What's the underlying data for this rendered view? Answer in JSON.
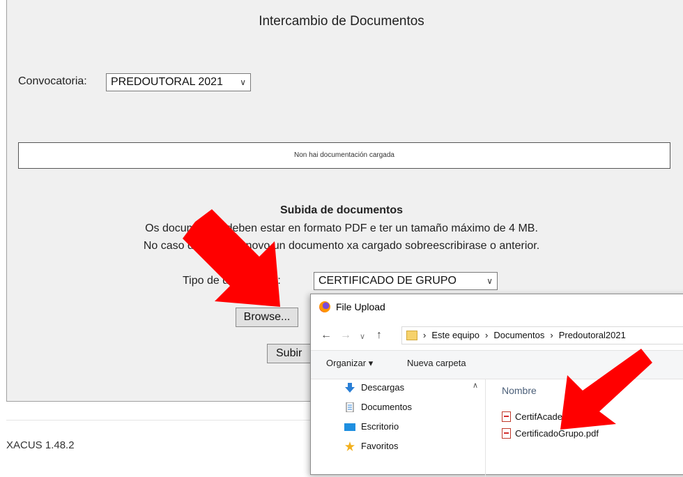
{
  "page": {
    "title": "Intercambio de Documentos",
    "convocatoria_label": "Convocatoria:",
    "convocatoria_value": "PREDOUTORAL 2021",
    "no_docs_text": "Non hai documentación cargada",
    "upload_title": "Subida de documentos",
    "upload_line1": "Os documentos deben estar en formato PDF e ter un tamaño máximo de 4 MB.",
    "upload_line2": "No caso de subir de novo un documento xa cargado sobreescribirase o anterior.",
    "tipo_label": "Tipo de documento:",
    "tipo_value": "CERTIFICADO DE GRUPO",
    "browse_label": "Browse...",
    "submit_label": "Subir",
    "footer": "XACUS 1.48.2"
  },
  "dialog": {
    "title": "File Upload",
    "path": [
      "Este equipo",
      "Documentos",
      "Predoutoral2021"
    ],
    "organize_label": "Organizar ▾",
    "new_folder_label": "Nueva carpeta",
    "column_name": "Nombre",
    "sidebar": [
      {
        "label": "Descargas",
        "icon": "download-icon"
      },
      {
        "label": "Documentos",
        "icon": "document-icon"
      },
      {
        "label": "Escritorio",
        "icon": "desktop-icon"
      },
      {
        "label": "Favoritos",
        "icon": "star-icon"
      }
    ],
    "files": [
      "CertifAcademico.pdf",
      "CertificadoGrupo.pdf"
    ]
  },
  "colors": {
    "arrow": "#ff0000",
    "panel_bg": "#f0f0f0"
  }
}
